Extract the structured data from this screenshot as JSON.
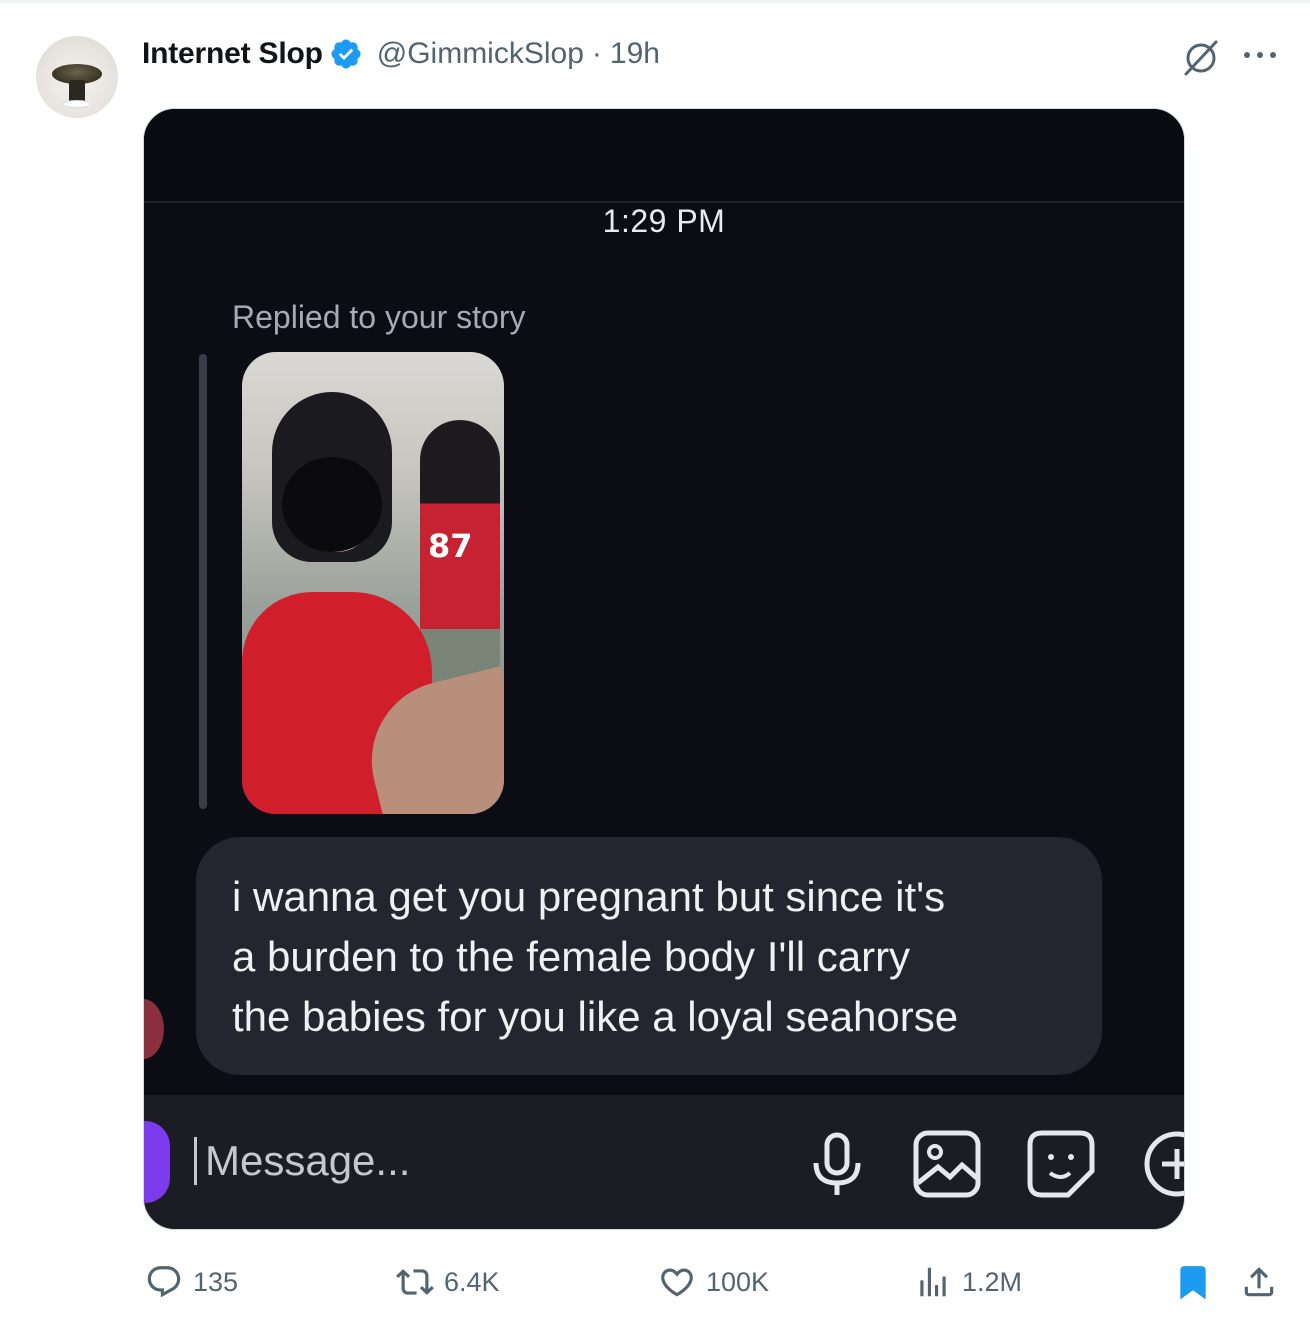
{
  "post": {
    "author_name": "Internet Slop",
    "handle": "@GimmickSlop",
    "separator": "·",
    "time_ago": "19h"
  },
  "media": {
    "message_time": "1:29 PM",
    "replied_label": "Replied to your story",
    "story_jersey_number": "87",
    "message_text": "i wanna get you pregnant but since it's\na burden to the female body I'll carry\nthe babies for you like a loyal seahorse",
    "composer_placeholder": "Message..."
  },
  "actions": {
    "replies": "135",
    "reposts": "6.4K",
    "likes": "100K",
    "views": "1.2M"
  },
  "colors": {
    "verified_blue": "#1d9bf0",
    "muted_text": "#536471",
    "chat_background": "#0c0d14",
    "bubble": "#24252f",
    "composer_accent": "#7c3aed"
  },
  "icons": [
    "verified-badge-icon",
    "grok-icon",
    "more-icon",
    "mic-icon",
    "gallery-icon",
    "sticker-icon",
    "plus-icon",
    "reply-icon",
    "repost-icon",
    "like-icon",
    "views-icon",
    "bookmark-icon",
    "share-icon"
  ]
}
